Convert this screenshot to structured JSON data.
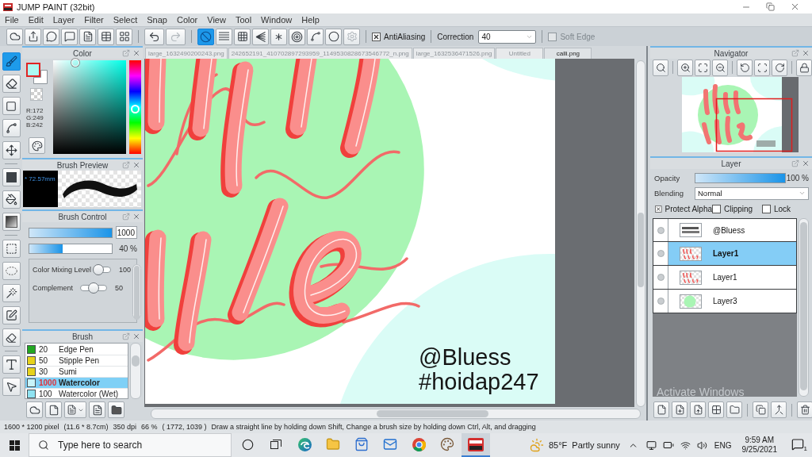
{
  "window": {
    "title": "JUMP PAINT (32bit)"
  },
  "menu": [
    "File",
    "Edit",
    "Layer",
    "Filter",
    "Select",
    "Snap",
    "Color",
    "View",
    "Tool",
    "Window",
    "Help"
  ],
  "toolbar": {
    "history": [
      {
        "disabled": false
      },
      {
        "disabled": true
      }
    ],
    "snap_modes": [
      {
        "selected": true
      },
      {
        "selected": false
      },
      {
        "selected": false
      },
      {
        "selected": false
      },
      {
        "selected": false
      },
      {
        "selected": false
      },
      {
        "selected": false
      },
      {
        "selected": false
      }
    ],
    "snap_settings": {
      "disabled": true
    },
    "antialiasing": {
      "label": "AntiAliasing",
      "checked": true
    },
    "correction": {
      "label": "Correction",
      "value": "40"
    },
    "soft_edge": {
      "label": "Soft Edge",
      "checked": false,
      "disabled": true
    }
  },
  "tools": [
    {
      "selected": true
    },
    {
      "selected": false
    },
    {
      "selected": false
    },
    {
      "selected": false
    },
    {
      "selected": false
    },
    {
      "selected": false
    },
    {
      "selected": false
    },
    {
      "selected": false
    },
    {
      "selected": false
    },
    {
      "selected": false
    },
    {
      "selected": false
    },
    {
      "selected": false
    },
    {
      "selected": false
    },
    {
      "selected": false
    },
    {
      "selected": false
    }
  ],
  "color_panel": {
    "title": "Color",
    "swatches": [
      {
        "color": "#acf9f2",
        "selected": true
      },
      {
        "color": "#ffffff",
        "selected": false
      }
    ],
    "readout": [
      "R:172",
      "G:249",
      "B:242"
    ]
  },
  "brush_preview": {
    "title": "Brush Preview",
    "size": "* 72.57mm"
  },
  "brush_control": {
    "title": "Brush Control",
    "sliders": [
      {
        "level": 1,
        "value": "1000"
      },
      {
        "level": 0.4,
        "value": "40 %"
      }
    ],
    "options": [
      {
        "label": "Color Mixing Level",
        "level": 0,
        "value": "100"
      },
      {
        "label": "Complement",
        "level": 0.5,
        "value": "50"
      }
    ]
  },
  "brush_panel": {
    "title": "Brush",
    "items": [
      {
        "size": "20",
        "name": "Edge Pen",
        "color": "#22a722",
        "selected": false
      },
      {
        "size": "50",
        "name": "Stipple Pen",
        "color": "#e6d21c",
        "selected": false
      },
      {
        "size": "30",
        "name": "Sumi",
        "color": "#e6d21c",
        "selected": false
      },
      {
        "size": "1000",
        "name": "Watercolor",
        "color": "#c8f4fa",
        "selected": true
      },
      {
        "size": "100",
        "name": "Watercolor (Wet)",
        "color": "#8fe3f2",
        "selected": false
      }
    ]
  },
  "document_tabs": [
    {
      "label": "large_1632490200243.png",
      "selected": false
    },
    {
      "label": "242652191_410702897293959_1149530828673546772_n.png",
      "selected": false
    },
    {
      "label": "large_1632536471526.png",
      "selected": false
    },
    {
      "label": "Untitled",
      "selected": false
    },
    {
      "label": "calli.png",
      "selected": true
    }
  ],
  "canvas": {
    "texts": [
      "@Bluess",
      "#hoidap247"
    ]
  },
  "navigator": {
    "title": "Navigator"
  },
  "layer_panel": {
    "title": "Layer",
    "opacity": {
      "label": "Opacity",
      "level": 1,
      "value": "100 %"
    },
    "blending": {
      "label": "Blending",
      "value": "Normal"
    },
    "options": [
      {
        "label": "Protect Alpha",
        "checked": true
      },
      {
        "label": "Clipping",
        "checked": false
      },
      {
        "label": "Lock",
        "checked": false
      }
    ],
    "layers": [
      {
        "name": "@Bluess",
        "kind": "text",
        "selected": false
      },
      {
        "name": "Layer1",
        "kind": "lettering",
        "selected": true
      },
      {
        "name": "Layer1",
        "kind": "lettering",
        "selected": false
      },
      {
        "name": "Layer3",
        "kind": "shape",
        "selected": false
      }
    ]
  },
  "status_bar": [
    "1600 * 1200 pixel",
    "(11.6 * 8.7cm)",
    "350 dpi",
    "66 %",
    "( 1772, 1039 )",
    "Draw a straight line by holding down Shift, Change a brush size by holding down Ctrl, Alt, and dragging"
  ],
  "taskbar": {
    "search": {
      "placeholder": "Type here to search"
    },
    "apps": [
      {
        "selected": false
      },
      {
        "selected": false
      },
      {
        "selected": false
      },
      {
        "selected": false
      },
      {
        "selected": false
      },
      {
        "selected": false
      },
      {
        "selected": true
      }
    ],
    "temperature": "85°F",
    "weather": "Partly sunny",
    "language": "ENG",
    "time": "9:59 AM",
    "date": "9/25/2021",
    "notifications": "1"
  },
  "system_overlay": {
    "text": "Activate Windows"
  }
}
